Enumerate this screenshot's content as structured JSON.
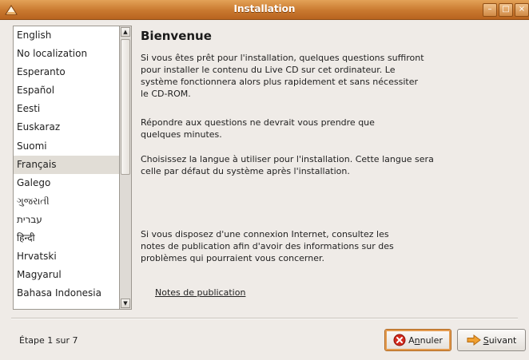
{
  "window": {
    "title": "Installation",
    "controls": {
      "minimize": "–",
      "maximize": "□",
      "close": "×"
    }
  },
  "languages": [
    "English",
    "No localization",
    "Esperanto",
    "Español",
    "Eesti",
    "Euskaraz",
    "Suomi",
    "Français",
    "Galego",
    "ગુજરાતી",
    "עברית",
    "हिन्दी",
    "Hrvatski",
    "Magyarul",
    "Bahasa Indonesia"
  ],
  "selected_language": "Français",
  "welcome": {
    "heading": "Bienvenue",
    "p1": "Si vous êtes prêt pour l'installation, quelques questions suffiront pour installer le contenu du Live CD sur cet ordinateur. Le système fonctionnera alors plus rapidement et sans nécessiter le CD-ROM.",
    "p2": "Répondre aux questions ne devrait vous prendre que quelques minutes.",
    "p3": "Choisissez la langue à utiliser pour l'installation. Cette langue sera celle par défaut du système après l'installation.",
    "p4": "Si vous disposez d'une connexion Internet, consultez les notes de publication afin d'avoir des informations sur des problèmes qui pourraient vous concerner.",
    "release_notes_link": "Notes de publication"
  },
  "footer": {
    "step": "Étape 1 sur 7",
    "cancel_pre": "A",
    "cancel_mnemonic": "n",
    "cancel_post": "nuler",
    "next_mnemonic": "S",
    "next_post": "uivant"
  },
  "colors": {
    "titlebar": "#c9782f",
    "selection": "#e1ddd6",
    "background": "#efebe7"
  },
  "icons": {
    "app": "installer-icon",
    "cancel": "cancel-icon",
    "next": "forward-arrow-icon"
  }
}
